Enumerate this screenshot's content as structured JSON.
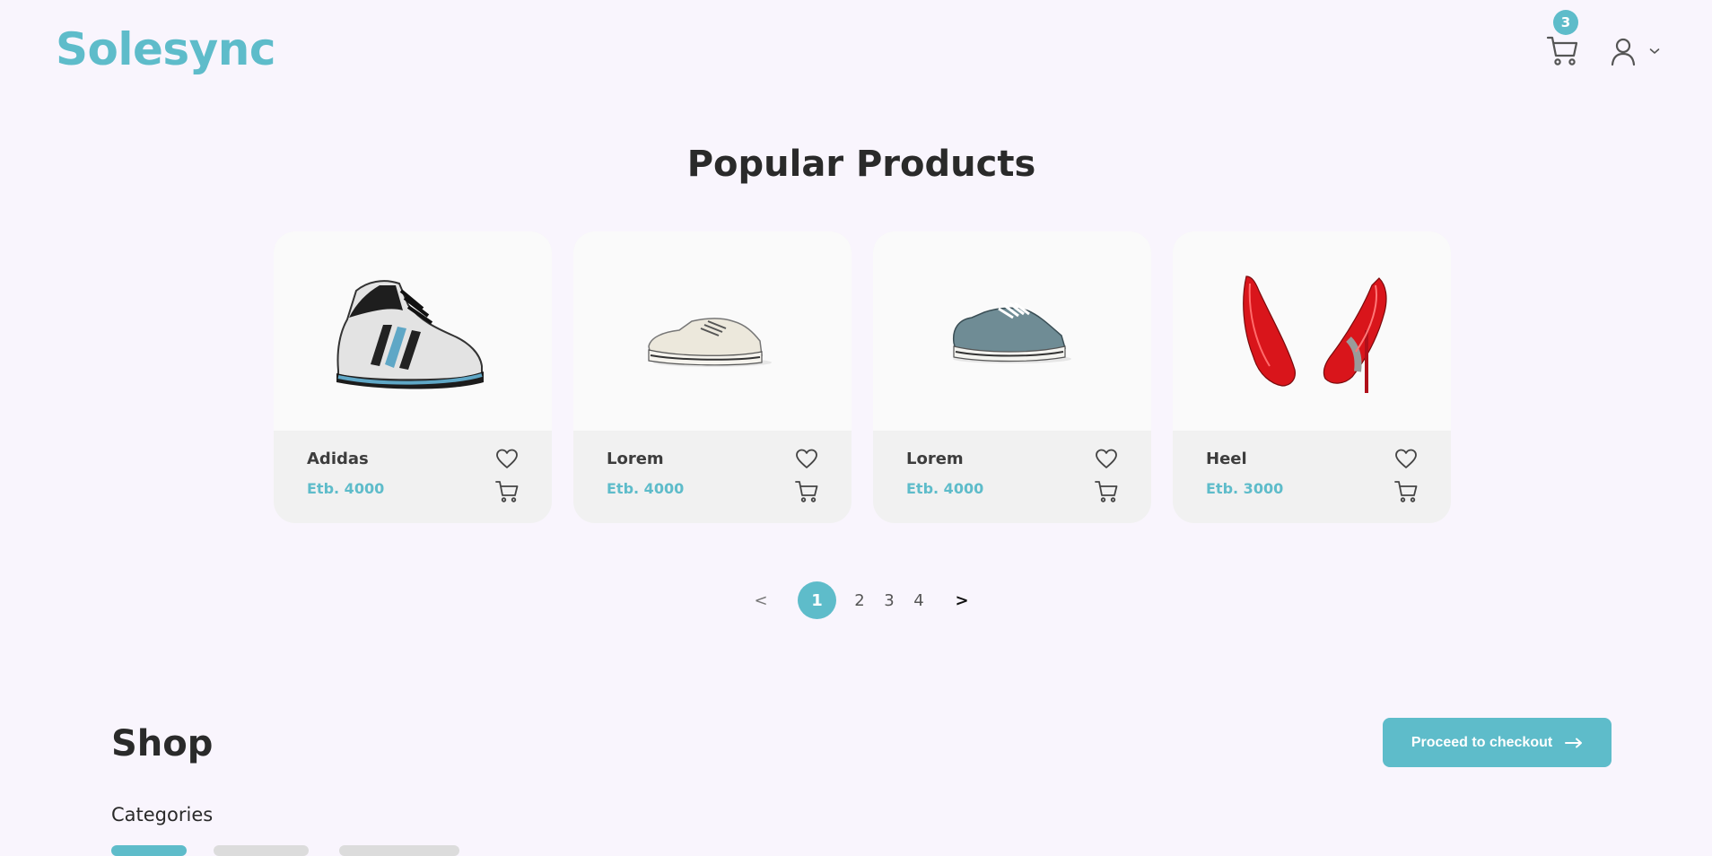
{
  "header": {
    "logo": "Solesync",
    "cart_count": "3",
    "cart_icon": "cart-icon",
    "user_icon": "user-icon"
  },
  "popular": {
    "title": "Popular Products",
    "products": [
      {
        "name": "Adidas",
        "price": "Etb. 4000",
        "image": "basketball-sneaker"
      },
      {
        "name": "Lorem",
        "price": "Etb. 4000",
        "image": "white-canvas-sneaker"
      },
      {
        "name": "Lorem",
        "price": "Etb. 4000",
        "image": "teal-canvas-sneaker"
      },
      {
        "name": "Heel",
        "price": "Etb. 3000",
        "image": "red-stiletto-heels"
      }
    ]
  },
  "pagination": {
    "prev": "<",
    "pages": [
      "1",
      "2",
      "3",
      "4"
    ],
    "active": "1",
    "next": ">"
  },
  "shop": {
    "title": "Shop",
    "checkout_label": "Proceed to checkout",
    "categories_label": "Categories"
  },
  "colors": {
    "accent": "#5ebcca",
    "background": "#f9f5fd",
    "card": "#f1f1f1"
  }
}
